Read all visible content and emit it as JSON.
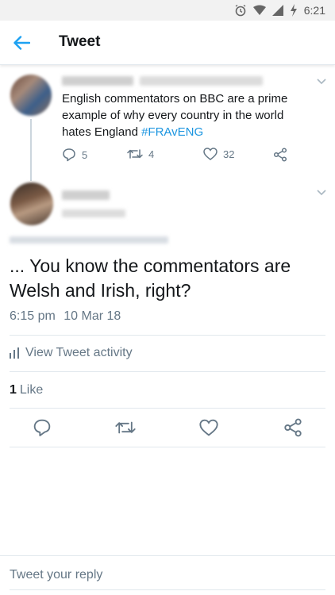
{
  "status_bar": {
    "time": "6:21",
    "icons": [
      "alarm-icon",
      "wifi-icon",
      "signal-icon",
      "charging-icon"
    ]
  },
  "app_bar": {
    "title": "Tweet",
    "back_icon": "back-arrow-icon"
  },
  "parent_tweet": {
    "text_before": "English commentators on BBC are a prime example of why every country in the world hates England ",
    "hashtag": "#FRAvENG",
    "replies": "5",
    "retweets": "4",
    "likes": "32"
  },
  "main_tweet": {
    "text": "... You know the commentators are Welsh and Irish, right?",
    "time": "6:15 pm",
    "date": "10 Mar 18",
    "activity_label": "View Tweet activity",
    "like_count": "1",
    "like_label": "Like"
  },
  "reply": {
    "placeholder": "Tweet your reply"
  },
  "colors": {
    "accent": "#1da1f2",
    "hashtag": "#1b95e0",
    "muted": "#657786",
    "divider": "#e1e8ed"
  }
}
